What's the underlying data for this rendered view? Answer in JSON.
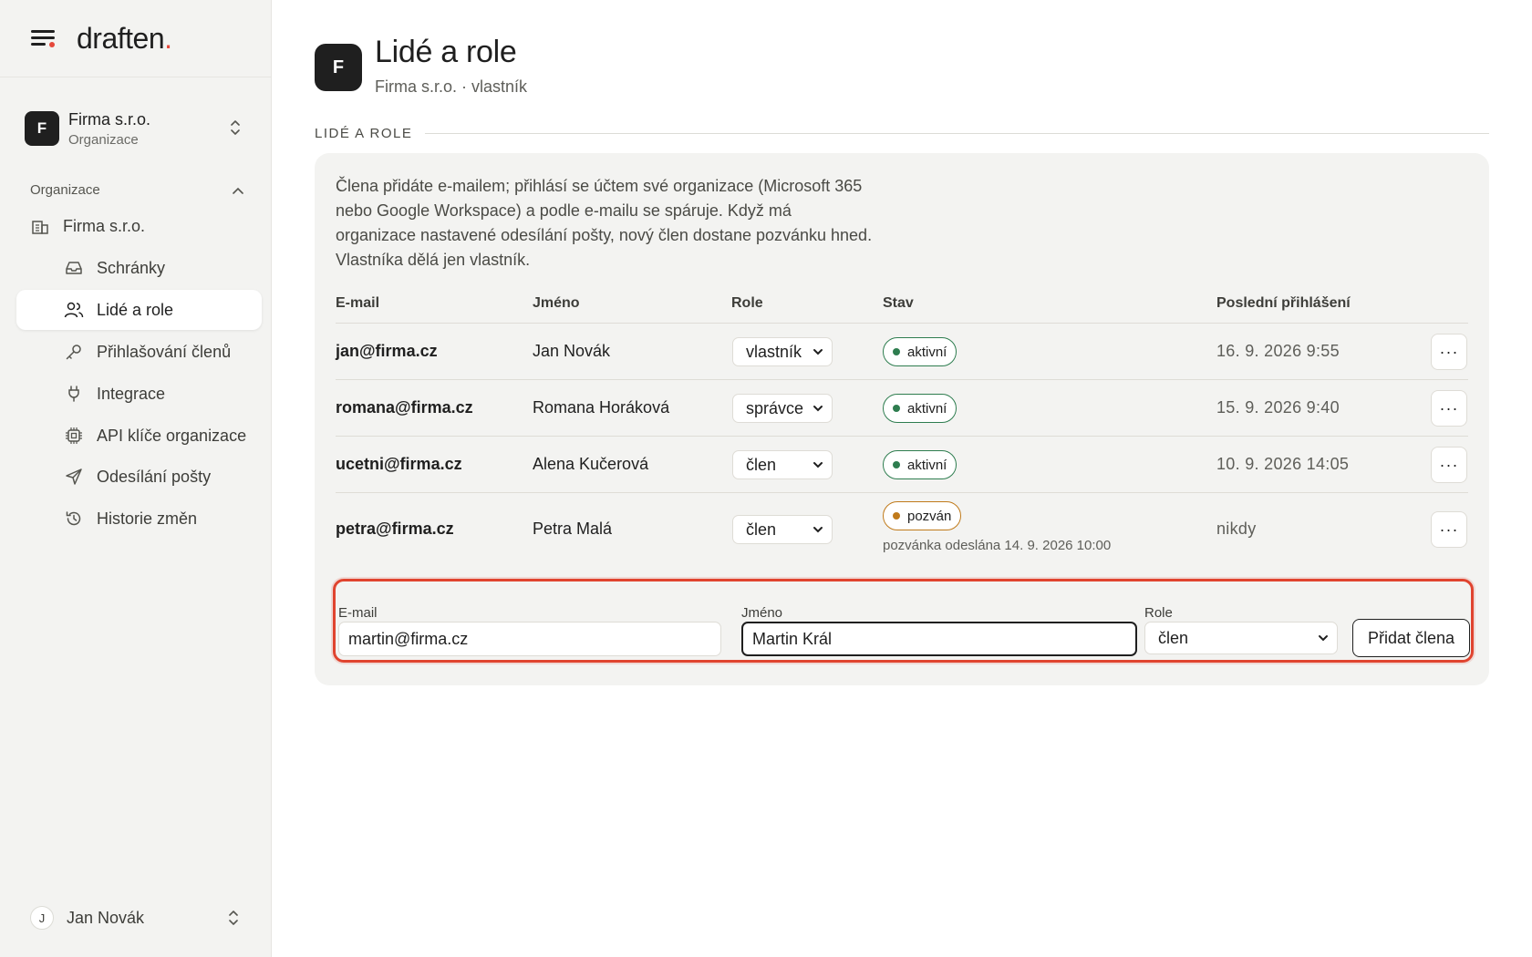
{
  "brand": {
    "name": "draften",
    "dot": "."
  },
  "org": {
    "initial": "F",
    "name": "Firma s.r.o.",
    "type": "Organizace"
  },
  "sidebar": {
    "section": "Organizace",
    "items": [
      {
        "label": "Firma s.r.o.",
        "icon": "building-icon"
      },
      {
        "label": "Schránky",
        "icon": "inbox-icon"
      },
      {
        "label": "Lidé a role",
        "icon": "users-icon"
      },
      {
        "label": "Přihlašování členů",
        "icon": "key-icon"
      },
      {
        "label": "Integrace",
        "icon": "plug-icon"
      },
      {
        "label": "API klíče organizace",
        "icon": "chip-icon"
      },
      {
        "label": "Odesílání pošty",
        "icon": "send-icon"
      },
      {
        "label": "Historie změn",
        "icon": "history-icon"
      }
    ],
    "active": "Lidé a role"
  },
  "user": {
    "initial": "J",
    "name": "Jan Novák"
  },
  "page": {
    "initial": "F",
    "title": "Lidé a role",
    "subtitle": "Firma s.r.o. · vlastník",
    "section_label": "LIDÉ A ROLE",
    "intro": "Člena přidáte e-mailem; přihlásí se účtem své organizace (Microsoft 365 nebo Google Workspace) a podle e-mailu se spáruje. Když má organizace nastavené odesílání pošty, nový člen dostane pozvánku hned. Vlastníka dělá jen vlastník."
  },
  "table": {
    "headers": {
      "email": "E-mail",
      "name": "Jméno",
      "role": "Role",
      "status": "Stav",
      "last_login": "Poslední přihlášení"
    },
    "rows": [
      {
        "email": "jan@firma.cz",
        "name": "Jan Novák",
        "role": "vlastník",
        "status": "aktivní",
        "last_login": "16. 9. 2026 9:55"
      },
      {
        "email": "romana@firma.cz",
        "name": "Romana Horáková",
        "role": "správce",
        "status": "aktivní",
        "last_login": "15. 9. 2026 9:40"
      },
      {
        "email": "ucetni@firma.cz",
        "name": "Alena Kučerová",
        "role": "člen",
        "status": "aktivní",
        "last_login": "10. 9. 2026 14:05"
      },
      {
        "email": "petra@firma.cz",
        "name": "Petra Malá",
        "role": "člen",
        "status": "pozván",
        "invite_note": "pozvánka odeslána 14. 9. 2026 10:00",
        "last_login": "nikdy"
      }
    ],
    "more_label": "···"
  },
  "add_form": {
    "email_label": "E-mail",
    "email_value": "martin@firma.cz",
    "name_label": "Jméno",
    "name_value": "Martin Král",
    "role_label": "Role",
    "role_value": "člen",
    "submit_label": "Přidat člena"
  },
  "colors": {
    "accent": "#e5483b",
    "active_status": "#2e7d4f",
    "invited_status": "#c07a1a",
    "highlight": "#e0442f"
  }
}
